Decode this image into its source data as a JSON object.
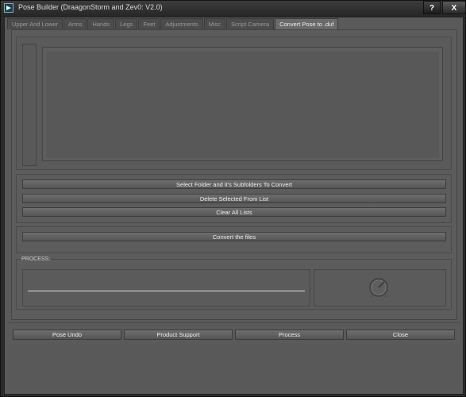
{
  "window": {
    "title": "Pose Builder (DraagonStorm and Zev0: V2.0)",
    "help_label": "?",
    "close_label": "X"
  },
  "tabs": [
    {
      "label": "Upper And Lower",
      "active": false
    },
    {
      "label": "Arms",
      "active": false
    },
    {
      "label": "Hands",
      "active": false
    },
    {
      "label": "Legs",
      "active": false
    },
    {
      "label": "Feet",
      "active": false
    },
    {
      "label": "Adjustments",
      "active": false
    },
    {
      "label": "Misc",
      "active": false
    },
    {
      "label": "Script Camera",
      "active": false
    },
    {
      "label": "Convert Pose to .duf",
      "active": true
    }
  ],
  "convert_panel": {
    "select_folder_label": "Select Folder and it's Subfolders To Convert",
    "delete_selected_label": "Delete Selected From List",
    "clear_all_label": "Clear All Lists",
    "convert_files_label": "Convert the files",
    "process_label": "PROCESS:"
  },
  "bottom_buttons": {
    "pose_undo": "Pose Undo",
    "product_support": "Product Support",
    "process": "Process",
    "close": "Close"
  },
  "icons": {
    "app": "app-logo-icon",
    "dial": "gauge-dial-icon"
  }
}
